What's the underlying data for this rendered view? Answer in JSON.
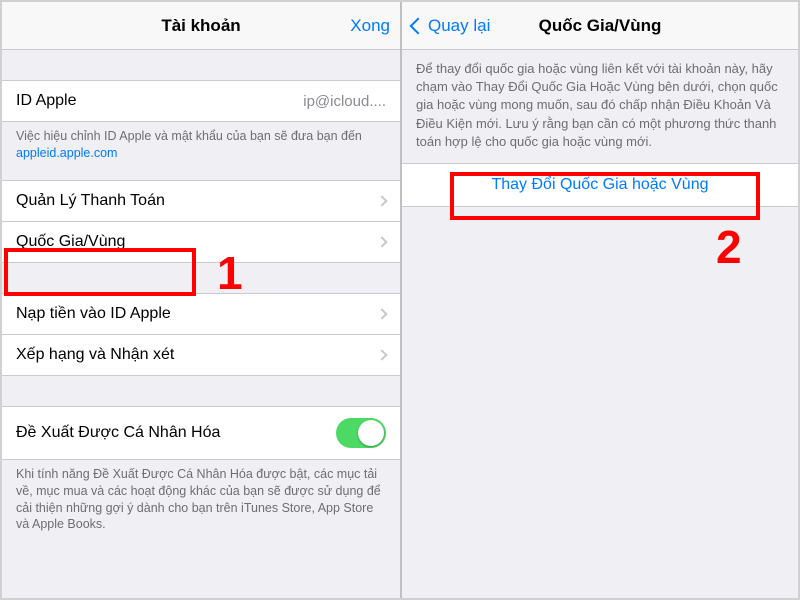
{
  "left": {
    "nav": {
      "title": "Tài khoản",
      "done": "Xong"
    },
    "appleId": {
      "label": "ID Apple",
      "value": "ip@icloud...."
    },
    "appleIdFooter": {
      "text": "Việc hiệu chỉnh ID Apple và mật khẩu của bạn sẽ đưa bạn đến ",
      "link": "appleid.apple.com"
    },
    "rows": {
      "payment": "Quản Lý Thanh Toán",
      "country": "Quốc Gia/Vùng",
      "addFunds": "Nạp tiền vào ID Apple",
      "ratings": "Xếp hạng và Nhận xét",
      "personalized": "Đề Xuất Được Cá Nhân Hóa"
    },
    "personalizedFooter": "Khi tính năng Đề Xuất Được Cá Nhân Hóa được bật, các mục tải về, mục mua và các hoạt động khác của bạn sẽ được sử dụng để cải thiện những gợi ý dành cho bạn trên iTunes Store, App Store và Apple Books."
  },
  "right": {
    "nav": {
      "back": "Quay lại",
      "title": "Quốc Gia/Vùng"
    },
    "desc": "Để thay đổi quốc gia hoặc vùng liên kết với tài khoản này, hãy chạm vào Thay Đổi Quốc Gia Hoặc Vùng bên dưới, chọn quốc gia hoặc vùng mong muốn, sau đó chấp nhận Điều Khoản Và Điều Kiện mới. Lưu ý rằng bạn cần có một phương thức thanh toán hợp lệ cho quốc gia hoặc vùng mới.",
    "action": "Thay Đổi Quốc Gia hoặc Vùng"
  },
  "annotations": {
    "one": "1",
    "two": "2"
  }
}
